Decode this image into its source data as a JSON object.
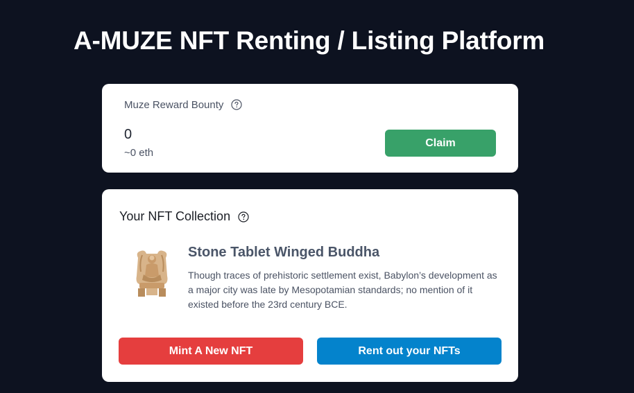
{
  "page": {
    "title": "A-MUZE NFT Renting / Listing Platform"
  },
  "reward": {
    "header": "Muze Reward Bounty",
    "help_icon": "question-circle-icon",
    "value": "0",
    "eth": "~0 eth",
    "claim_label": "Claim"
  },
  "collection": {
    "header": "Your NFT Collection",
    "help_icon": "question-circle-icon",
    "item": {
      "image_icon": "stone-tablet-buddha-image",
      "title": "Stone Tablet Winged Buddha",
      "description": "Though traces of prehistoric settlement exist, Babylon’s development as a major city was late by Mesopotamian standards; no mention of it existed before the 23rd century BCE."
    },
    "mint_label": "Mint A New NFT",
    "rent_label": "Rent out your NFTs"
  },
  "colors": {
    "background": "#0d1220",
    "claim": "#38a169",
    "mint": "#e53e3e",
    "rent": "#0483cc"
  }
}
